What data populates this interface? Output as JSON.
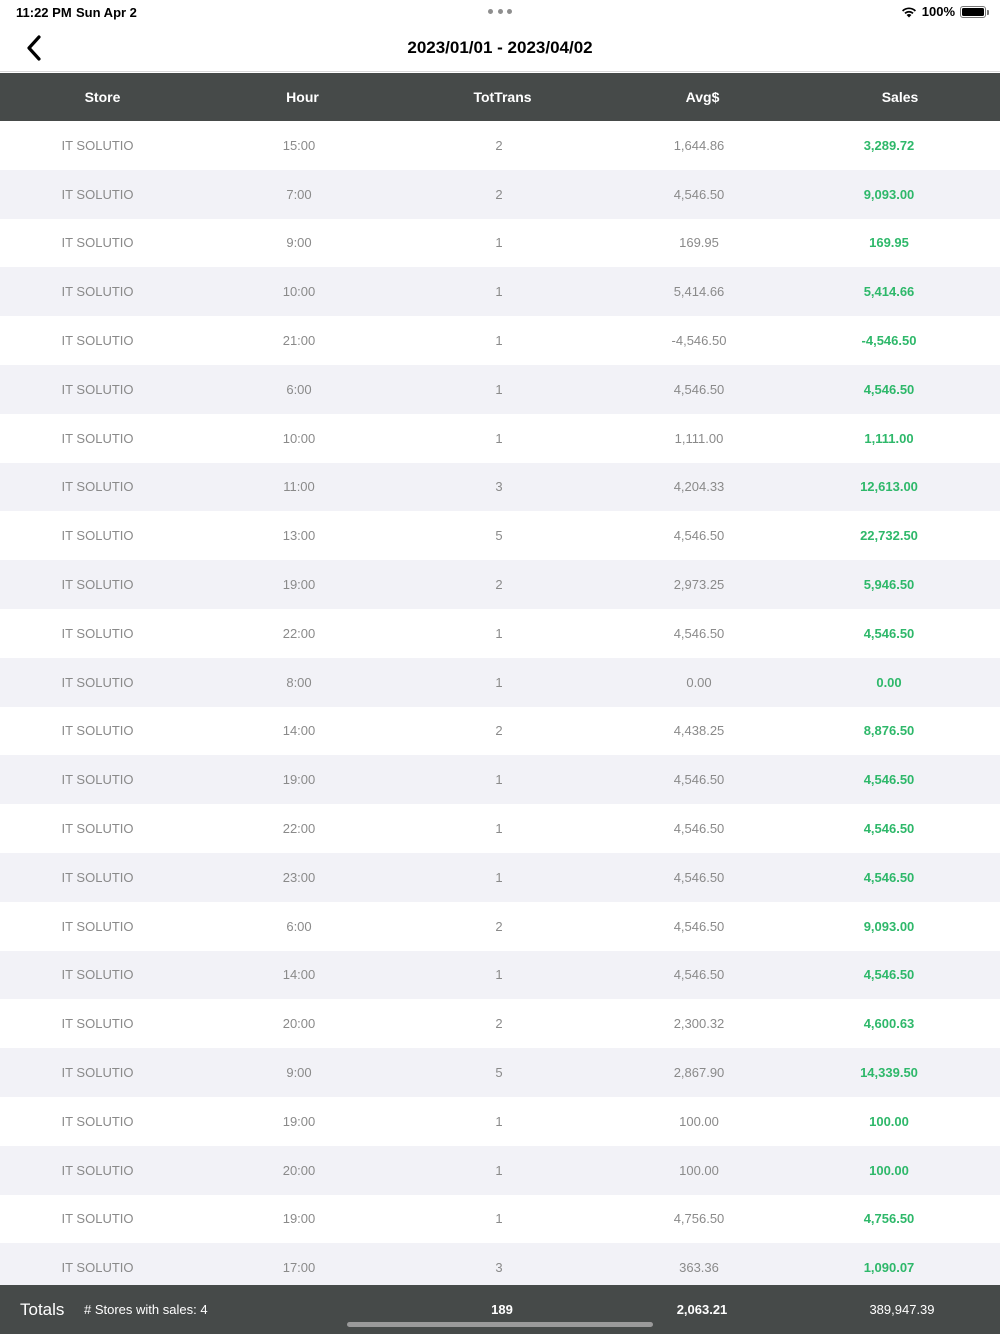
{
  "status_bar": {
    "time": "11:22 PM",
    "date": "Sun Apr 2",
    "battery": "100%"
  },
  "nav": {
    "title": "2023/01/01 - 2023/04/02",
    "back_icon": "chevron-left-icon"
  },
  "colors": {
    "header_bg": "#464a49",
    "sales_green": "#2eb86a",
    "alt_row": "#f2f2f7"
  },
  "table": {
    "headers": [
      "Store",
      "Hour",
      "TotTrans",
      "Avg$",
      "Sales"
    ],
    "rows": [
      [
        "IT SOLUTIO",
        "15:00",
        "2",
        "1,644.86",
        "3,289.72"
      ],
      [
        "IT SOLUTIO",
        "7:00",
        "2",
        "4,546.50",
        "9,093.00"
      ],
      [
        "IT SOLUTIO",
        "9:00",
        "1",
        "169.95",
        "169.95"
      ],
      [
        "IT SOLUTIO",
        "10:00",
        "1",
        "5,414.66",
        "5,414.66"
      ],
      [
        "IT SOLUTIO",
        "21:00",
        "1",
        "-4,546.50",
        "-4,546.50"
      ],
      [
        "IT SOLUTIO",
        "6:00",
        "1",
        "4,546.50",
        "4,546.50"
      ],
      [
        "IT SOLUTIO",
        "10:00",
        "1",
        "1,111.00",
        "1,111.00"
      ],
      [
        "IT SOLUTIO",
        "11:00",
        "3",
        "4,204.33",
        "12,613.00"
      ],
      [
        "IT SOLUTIO",
        "13:00",
        "5",
        "4,546.50",
        "22,732.50"
      ],
      [
        "IT SOLUTIO",
        "19:00",
        "2",
        "2,973.25",
        "5,946.50"
      ],
      [
        "IT SOLUTIO",
        "22:00",
        "1",
        "4,546.50",
        "4,546.50"
      ],
      [
        "IT SOLUTIO",
        "8:00",
        "1",
        "0.00",
        "0.00"
      ],
      [
        "IT SOLUTIO",
        "14:00",
        "2",
        "4,438.25",
        "8,876.50"
      ],
      [
        "IT SOLUTIO",
        "19:00",
        "1",
        "4,546.50",
        "4,546.50"
      ],
      [
        "IT SOLUTIO",
        "22:00",
        "1",
        "4,546.50",
        "4,546.50"
      ],
      [
        "IT SOLUTIO",
        "23:00",
        "1",
        "4,546.50",
        "4,546.50"
      ],
      [
        "IT SOLUTIO",
        "6:00",
        "2",
        "4,546.50",
        "9,093.00"
      ],
      [
        "IT SOLUTIO",
        "14:00",
        "1",
        "4,546.50",
        "4,546.50"
      ],
      [
        "IT SOLUTIO",
        "20:00",
        "2",
        "2,300.32",
        "4,600.63"
      ],
      [
        "IT SOLUTIO",
        "9:00",
        "5",
        "2,867.90",
        "14,339.50"
      ],
      [
        "IT SOLUTIO",
        "19:00",
        "1",
        "100.00",
        "100.00"
      ],
      [
        "IT SOLUTIO",
        "20:00",
        "1",
        "100.00",
        "100.00"
      ],
      [
        "IT SOLUTIO",
        "19:00",
        "1",
        "4,756.50",
        "4,756.50"
      ],
      [
        "IT SOLUTIO",
        "17:00",
        "3",
        "363.36",
        "1,090.07"
      ]
    ]
  },
  "totals": {
    "label": "Totals",
    "stores_with_sales": "# Stores with sales: 4",
    "tot_trans": "189",
    "avg": "2,063.21",
    "sales": "389,947.39"
  }
}
